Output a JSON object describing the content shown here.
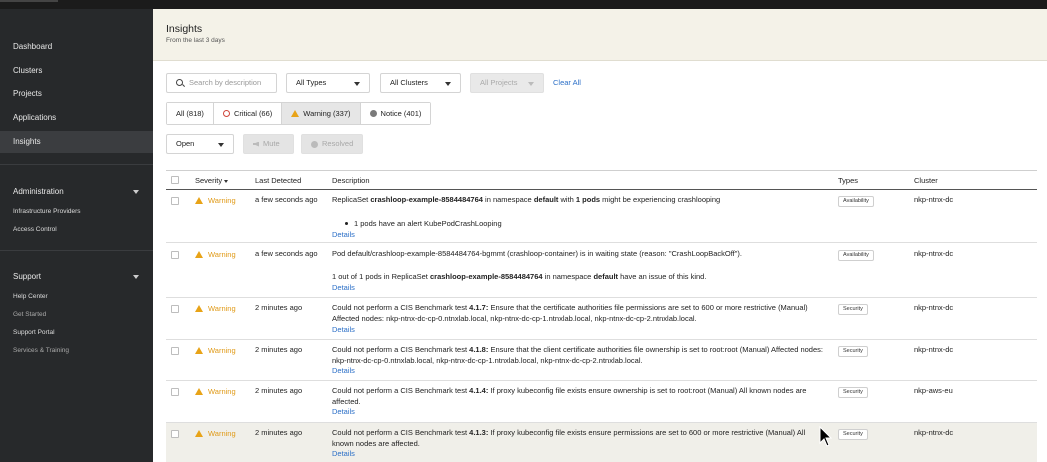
{
  "sidebar": {
    "nav": [
      "Dashboard",
      "Clusters",
      "Projects",
      "Applications",
      "Insights"
    ],
    "administration": {
      "title": "Administration",
      "items": [
        "Infrastructure Providers",
        "Access Control"
      ]
    },
    "support": {
      "title": "Support",
      "items": [
        "Help Center",
        "Get Started",
        "Support Portal",
        "Services & Training"
      ]
    }
  },
  "header": {
    "title": "Insights",
    "subtitle": "From the last 3 days"
  },
  "filters": {
    "search_placeholder": "Search by description",
    "types": "All Types",
    "clusters": "All Clusters",
    "projects": "All Projects",
    "clear": "Clear All"
  },
  "tabs": [
    "All (818)",
    "Critical (66)",
    "Warning (337)",
    "Notice (401)"
  ],
  "actions": {
    "status": "Open",
    "mute": "Mute",
    "resolved": "Resolved"
  },
  "table": {
    "columns": [
      "Severity",
      "Last Detected",
      "Description",
      "Types",
      "Cluster"
    ],
    "details_label": "Details",
    "rows": [
      {
        "severity": "Warning",
        "detected": "a few seconds ago",
        "desc": [
          "ReplicaSet ",
          "crashloop-example-8584484764",
          " in namespace ",
          "default",
          " with ",
          "1 pods",
          " might be experiencing crashlooping"
        ],
        "bullet": "1 pods have an alert KubePodCrashLooping",
        "type": "Availability",
        "cluster": "nkp-ntnx-dc"
      },
      {
        "severity": "Warning",
        "detected": "a few seconds ago",
        "line1": "Pod default/crashloop-example-8584484764-bgmmt (crashloop-container) is in waiting state (reason: \"CrashLoopBackOff\").",
        "desc": [
          "1 out of 1 pods in ReplicaSet ",
          "crashloop-example-8584484764",
          " in namespace ",
          "default",
          " have an issue of this kind."
        ],
        "type": "Availability",
        "cluster": "nkp-ntnx-dc"
      },
      {
        "severity": "Warning",
        "detected": "2 minutes ago",
        "test": "4.1.7:",
        "text": "Ensure that the certificate authorities file permissions are set to 600 or more restrictive (Manual) Affected nodes: nkp-ntnx-dc-cp-0.ntnxlab.local, nkp-ntnx-dc-cp-1.ntnxlab.local, nkp-ntnx-dc-cp-2.ntnxlab.local.",
        "type": "Security",
        "cluster": "nkp-ntnx-dc"
      },
      {
        "severity": "Warning",
        "detected": "2 minutes ago",
        "test": "4.1.8:",
        "text": "Ensure that the client certificate authorities file ownership is set to root:root (Manual) Affected nodes: nkp-ntnx-dc-cp-0.ntnxlab.local, nkp-ntnx-dc-cp-1.ntnxlab.local, nkp-ntnx-dc-cp-2.ntnxlab.local.",
        "type": "Security",
        "cluster": "nkp-ntnx-dc"
      },
      {
        "severity": "Warning",
        "detected": "2 minutes ago",
        "test": "4.1.4:",
        "text": "If proxy kubeconfig file exists ensure ownership is set to root:root (Manual) All known nodes are affected.",
        "type": "Security",
        "cluster": "nkp-aws-eu"
      },
      {
        "severity": "Warning",
        "detected": "2 minutes ago",
        "test": "4.1.3:",
        "text": "If proxy kubeconfig file exists ensure permissions are set to 600 or more restrictive (Manual) All known nodes are affected.",
        "type": "Security",
        "cluster": "nkp-ntnx-dc"
      }
    ],
    "cis_prefix": "Could not perform a CIS Benchmark test "
  }
}
